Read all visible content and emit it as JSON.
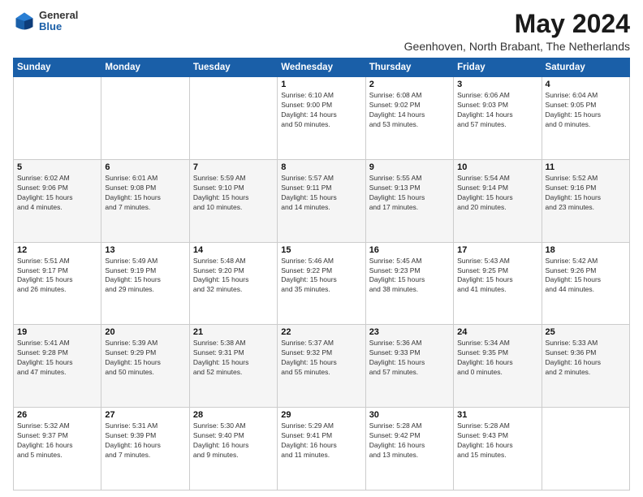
{
  "logo": {
    "general": "General",
    "blue": "Blue"
  },
  "title": "May 2024",
  "subtitle": "Geenhoven, North Brabant, The Netherlands",
  "headers": [
    "Sunday",
    "Monday",
    "Tuesday",
    "Wednesday",
    "Thursday",
    "Friday",
    "Saturday"
  ],
  "weeks": [
    [
      {
        "day": "",
        "info": ""
      },
      {
        "day": "",
        "info": ""
      },
      {
        "day": "",
        "info": ""
      },
      {
        "day": "1",
        "info": "Sunrise: 6:10 AM\nSunset: 9:00 PM\nDaylight: 14 hours\nand 50 minutes."
      },
      {
        "day": "2",
        "info": "Sunrise: 6:08 AM\nSunset: 9:02 PM\nDaylight: 14 hours\nand 53 minutes."
      },
      {
        "day": "3",
        "info": "Sunrise: 6:06 AM\nSunset: 9:03 PM\nDaylight: 14 hours\nand 57 minutes."
      },
      {
        "day": "4",
        "info": "Sunrise: 6:04 AM\nSunset: 9:05 PM\nDaylight: 15 hours\nand 0 minutes."
      }
    ],
    [
      {
        "day": "5",
        "info": "Sunrise: 6:02 AM\nSunset: 9:06 PM\nDaylight: 15 hours\nand 4 minutes."
      },
      {
        "day": "6",
        "info": "Sunrise: 6:01 AM\nSunset: 9:08 PM\nDaylight: 15 hours\nand 7 minutes."
      },
      {
        "day": "7",
        "info": "Sunrise: 5:59 AM\nSunset: 9:10 PM\nDaylight: 15 hours\nand 10 minutes."
      },
      {
        "day": "8",
        "info": "Sunrise: 5:57 AM\nSunset: 9:11 PM\nDaylight: 15 hours\nand 14 minutes."
      },
      {
        "day": "9",
        "info": "Sunrise: 5:55 AM\nSunset: 9:13 PM\nDaylight: 15 hours\nand 17 minutes."
      },
      {
        "day": "10",
        "info": "Sunrise: 5:54 AM\nSunset: 9:14 PM\nDaylight: 15 hours\nand 20 minutes."
      },
      {
        "day": "11",
        "info": "Sunrise: 5:52 AM\nSunset: 9:16 PM\nDaylight: 15 hours\nand 23 minutes."
      }
    ],
    [
      {
        "day": "12",
        "info": "Sunrise: 5:51 AM\nSunset: 9:17 PM\nDaylight: 15 hours\nand 26 minutes."
      },
      {
        "day": "13",
        "info": "Sunrise: 5:49 AM\nSunset: 9:19 PM\nDaylight: 15 hours\nand 29 minutes."
      },
      {
        "day": "14",
        "info": "Sunrise: 5:48 AM\nSunset: 9:20 PM\nDaylight: 15 hours\nand 32 minutes."
      },
      {
        "day": "15",
        "info": "Sunrise: 5:46 AM\nSunset: 9:22 PM\nDaylight: 15 hours\nand 35 minutes."
      },
      {
        "day": "16",
        "info": "Sunrise: 5:45 AM\nSunset: 9:23 PM\nDaylight: 15 hours\nand 38 minutes."
      },
      {
        "day": "17",
        "info": "Sunrise: 5:43 AM\nSunset: 9:25 PM\nDaylight: 15 hours\nand 41 minutes."
      },
      {
        "day": "18",
        "info": "Sunrise: 5:42 AM\nSunset: 9:26 PM\nDaylight: 15 hours\nand 44 minutes."
      }
    ],
    [
      {
        "day": "19",
        "info": "Sunrise: 5:41 AM\nSunset: 9:28 PM\nDaylight: 15 hours\nand 47 minutes."
      },
      {
        "day": "20",
        "info": "Sunrise: 5:39 AM\nSunset: 9:29 PM\nDaylight: 15 hours\nand 50 minutes."
      },
      {
        "day": "21",
        "info": "Sunrise: 5:38 AM\nSunset: 9:31 PM\nDaylight: 15 hours\nand 52 minutes."
      },
      {
        "day": "22",
        "info": "Sunrise: 5:37 AM\nSunset: 9:32 PM\nDaylight: 15 hours\nand 55 minutes."
      },
      {
        "day": "23",
        "info": "Sunrise: 5:36 AM\nSunset: 9:33 PM\nDaylight: 15 hours\nand 57 minutes."
      },
      {
        "day": "24",
        "info": "Sunrise: 5:34 AM\nSunset: 9:35 PM\nDaylight: 16 hours\nand 0 minutes."
      },
      {
        "day": "25",
        "info": "Sunrise: 5:33 AM\nSunset: 9:36 PM\nDaylight: 16 hours\nand 2 minutes."
      }
    ],
    [
      {
        "day": "26",
        "info": "Sunrise: 5:32 AM\nSunset: 9:37 PM\nDaylight: 16 hours\nand 5 minutes."
      },
      {
        "day": "27",
        "info": "Sunrise: 5:31 AM\nSunset: 9:39 PM\nDaylight: 16 hours\nand 7 minutes."
      },
      {
        "day": "28",
        "info": "Sunrise: 5:30 AM\nSunset: 9:40 PM\nDaylight: 16 hours\nand 9 minutes."
      },
      {
        "day": "29",
        "info": "Sunrise: 5:29 AM\nSunset: 9:41 PM\nDaylight: 16 hours\nand 11 minutes."
      },
      {
        "day": "30",
        "info": "Sunrise: 5:28 AM\nSunset: 9:42 PM\nDaylight: 16 hours\nand 13 minutes."
      },
      {
        "day": "31",
        "info": "Sunrise: 5:28 AM\nSunset: 9:43 PM\nDaylight: 16 hours\nand 15 minutes."
      },
      {
        "day": "",
        "info": ""
      }
    ]
  ]
}
